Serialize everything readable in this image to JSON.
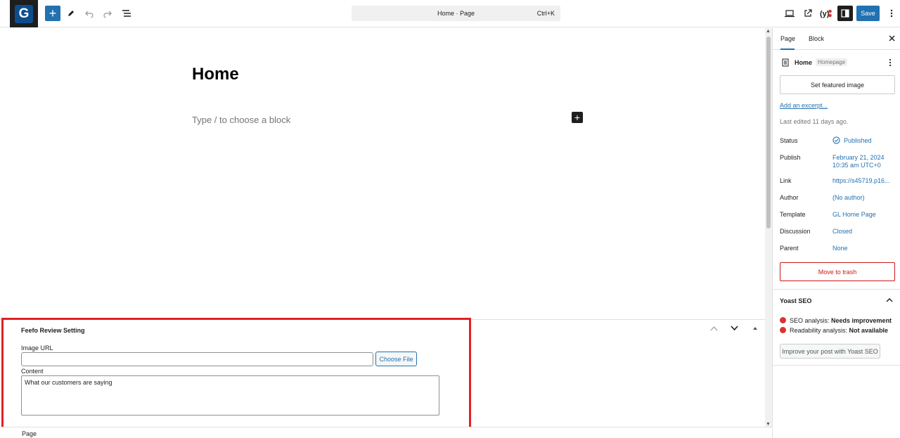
{
  "topbar": {
    "logo_letter": "G",
    "command_title": "Home · Page",
    "command_shortcut": "Ctrl+K",
    "save_label": "Save"
  },
  "canvas": {
    "page_title": "Home",
    "block_placeholder": "Type / to choose a block"
  },
  "metabox": {
    "title": "Feefo Review Setting",
    "image_url_label": "Image URL",
    "image_url_value": "",
    "choose_file_label": "Choose File",
    "content_label": "Content",
    "content_value": "What our customers are saying"
  },
  "footer": {
    "breadcrumb": "Page"
  },
  "sidebar": {
    "tabs": [
      "Page",
      "Block"
    ],
    "page_name": "Home",
    "page_badge": "Homepage",
    "featured_image_label": "Set featured image",
    "excerpt_link": "Add an excerpt...",
    "last_edited": "Last edited 11 days ago.",
    "rows": [
      {
        "label": "Status",
        "value": "Published"
      },
      {
        "label": "Publish",
        "value": "February 21, 2024",
        "value2": "10:35 am UTC+0"
      },
      {
        "label": "Link",
        "value": "https://s45719.p16..."
      },
      {
        "label": "Author",
        "value": "(No author)"
      },
      {
        "label": "Template",
        "value": "GL Home Page"
      },
      {
        "label": "Discussion",
        "value": "Closed"
      },
      {
        "label": "Parent",
        "value": "None"
      }
    ],
    "trash_label": "Move to trash",
    "yoast": {
      "title": "Yoast SEO",
      "seo_label": "SEO analysis: ",
      "seo_value": "Needs improvement",
      "readability_label": "Readability analysis: ",
      "readability_value": "Not available",
      "improve_button": "Improve your post with Yoast SEO"
    }
  },
  "colors": {
    "accent": "#2271b1",
    "danger": "#cc1818",
    "highlight": "#e12127"
  }
}
